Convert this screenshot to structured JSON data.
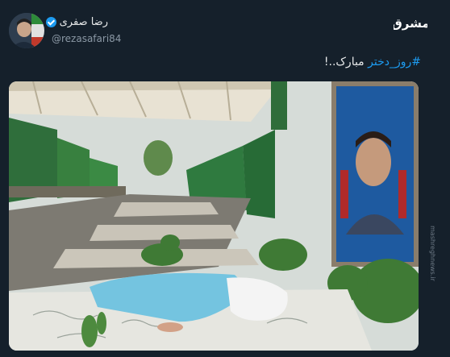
{
  "user": {
    "display_name": "رضا صفری",
    "handle": "@rezasafari84",
    "verified": true
  },
  "tweet": {
    "hashtag": "#روز_دختر",
    "text": " مبارک..!"
  },
  "branding": {
    "logo_text": "مشرق",
    "watermark": "mashreghnews.ir"
  },
  "colors": {
    "background": "#15202b",
    "accent": "#1d9bf0",
    "text": "#e7e9ea",
    "muted": "#8b98a5"
  }
}
